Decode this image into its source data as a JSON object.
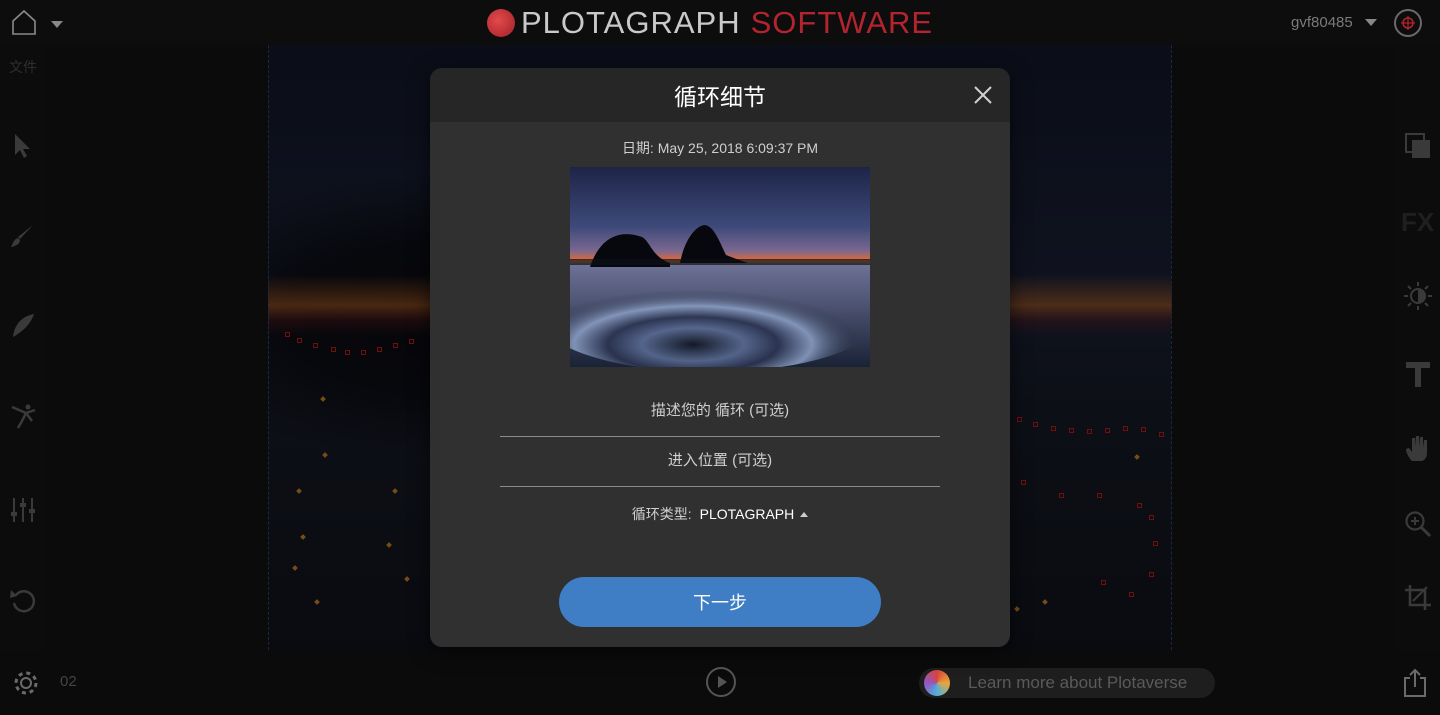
{
  "header": {
    "logo_primary": "PLOTAGRAPH",
    "logo_secondary": "SOFTWARE",
    "username": "gvf80485"
  },
  "sidebar_left": {
    "file_label": "文件",
    "tools": [
      "select-arrow-icon",
      "brush-icon",
      "feather-icon",
      "dancer-icon",
      "sliders-icon",
      "undo-icon"
    ]
  },
  "sidebar_right": {
    "tools": [
      "layers-icon",
      "fx-icon",
      "brightness-icon",
      "text-icon",
      "hand-icon",
      "zoom-icon",
      "crop-icon"
    ],
    "fx_label": "FX"
  },
  "bottom": {
    "frame_number": "02",
    "learn_more": "Learn more about Plotaverse"
  },
  "dialog": {
    "title": "循环细节",
    "date_label": "日期: May 25, 2018 6:09:37 PM",
    "describe_placeholder": "描述您的 循环 (可选)",
    "location_placeholder": "进入位置 (可选)",
    "loop_type_label": "循环类型:",
    "loop_type_value": "PLOTAGRAPH",
    "next_button": "下一步"
  },
  "colors": {
    "accent_button": "#3f7ec4",
    "logo_red": "#b3242e",
    "dialog_bg": "#303030",
    "dialog_header": "#262626"
  }
}
